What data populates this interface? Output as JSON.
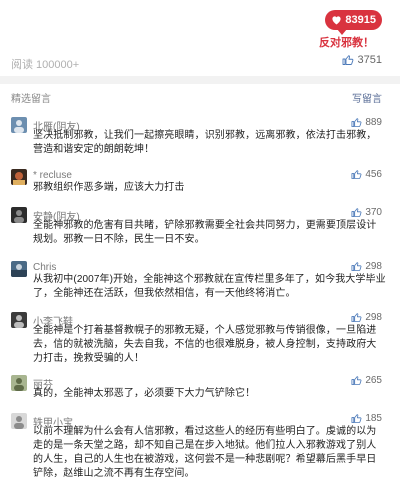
{
  "header": {
    "like_count_badge": "83915",
    "slogan": "反对邪教！",
    "reads_label": "阅读 100000+",
    "total_likes": "3751"
  },
  "comments_section": {
    "title": "精选留言",
    "write_label": "写留言"
  },
  "comments": [
    {
      "nickname": "北雁(阴友)",
      "likes": "889",
      "avatar_color": "#6d8fb0",
      "text": "坚决抵制邪教，让我们一起擦亮眼睛，识别邪教，远离邪教，依法打击邪教，营造和谐安定的朗朗乾坤！"
    },
    {
      "nickname": "* recluse",
      "likes": "456",
      "avatar_color": "#c0623a",
      "text": "邪教组织作恶多端，应该大力打击"
    },
    {
      "nickname": "安静(阴友)",
      "likes": "370",
      "avatar_color": "#2c2c2c",
      "text": "全能神邪教的危害有目共睹，铲除邪教需要全社会共同努力，更需要顶层设计规划。邪教一日不除，民生一日不安。"
    },
    {
      "nickname": "Chris",
      "likes": "298",
      "avatar_color": "#4a6a86",
      "text": "从我初中(2007年)开始，全能神这个邪教就在宣传栏里多年了，如今我大学毕业了，全能神还在活跃，但我依然相信，有一天他终将消亡。"
    },
    {
      "nickname": "小李飞鞋",
      "likes": "298",
      "avatar_color": "#3b3b3b",
      "text": "全能神是个打着基督教幌子的邪教无疑，个人感觉邪教与传销很像，一旦陷进去，信的就被洗脑，失去自我，不信的也很难脱身，被人身控制，支持政府大力打击，挽救受骗的人！"
    },
    {
      "nickname": "丽芬",
      "likes": "265",
      "avatar_color": "#8a9a6a",
      "text": "真的，全能神太邪恶了，必须要下大力气铲除它！"
    },
    {
      "nickname": "轶甲小宝",
      "likes": "185",
      "avatar_color": "#b8b8b8",
      "text": "以前不理解为什么会有人信邪教，看过这些人的经历有些明白了。虔诚的以为走的是一条天堂之路，却不知自己是在步入地狱。他们拉人入邪教游戏了别人的人生，自己的人生也在被游戏，这何尝不是一种悲剧呢？希望幕后黑手早日铲除，赵维山之流不再有生存空间。"
    }
  ]
}
